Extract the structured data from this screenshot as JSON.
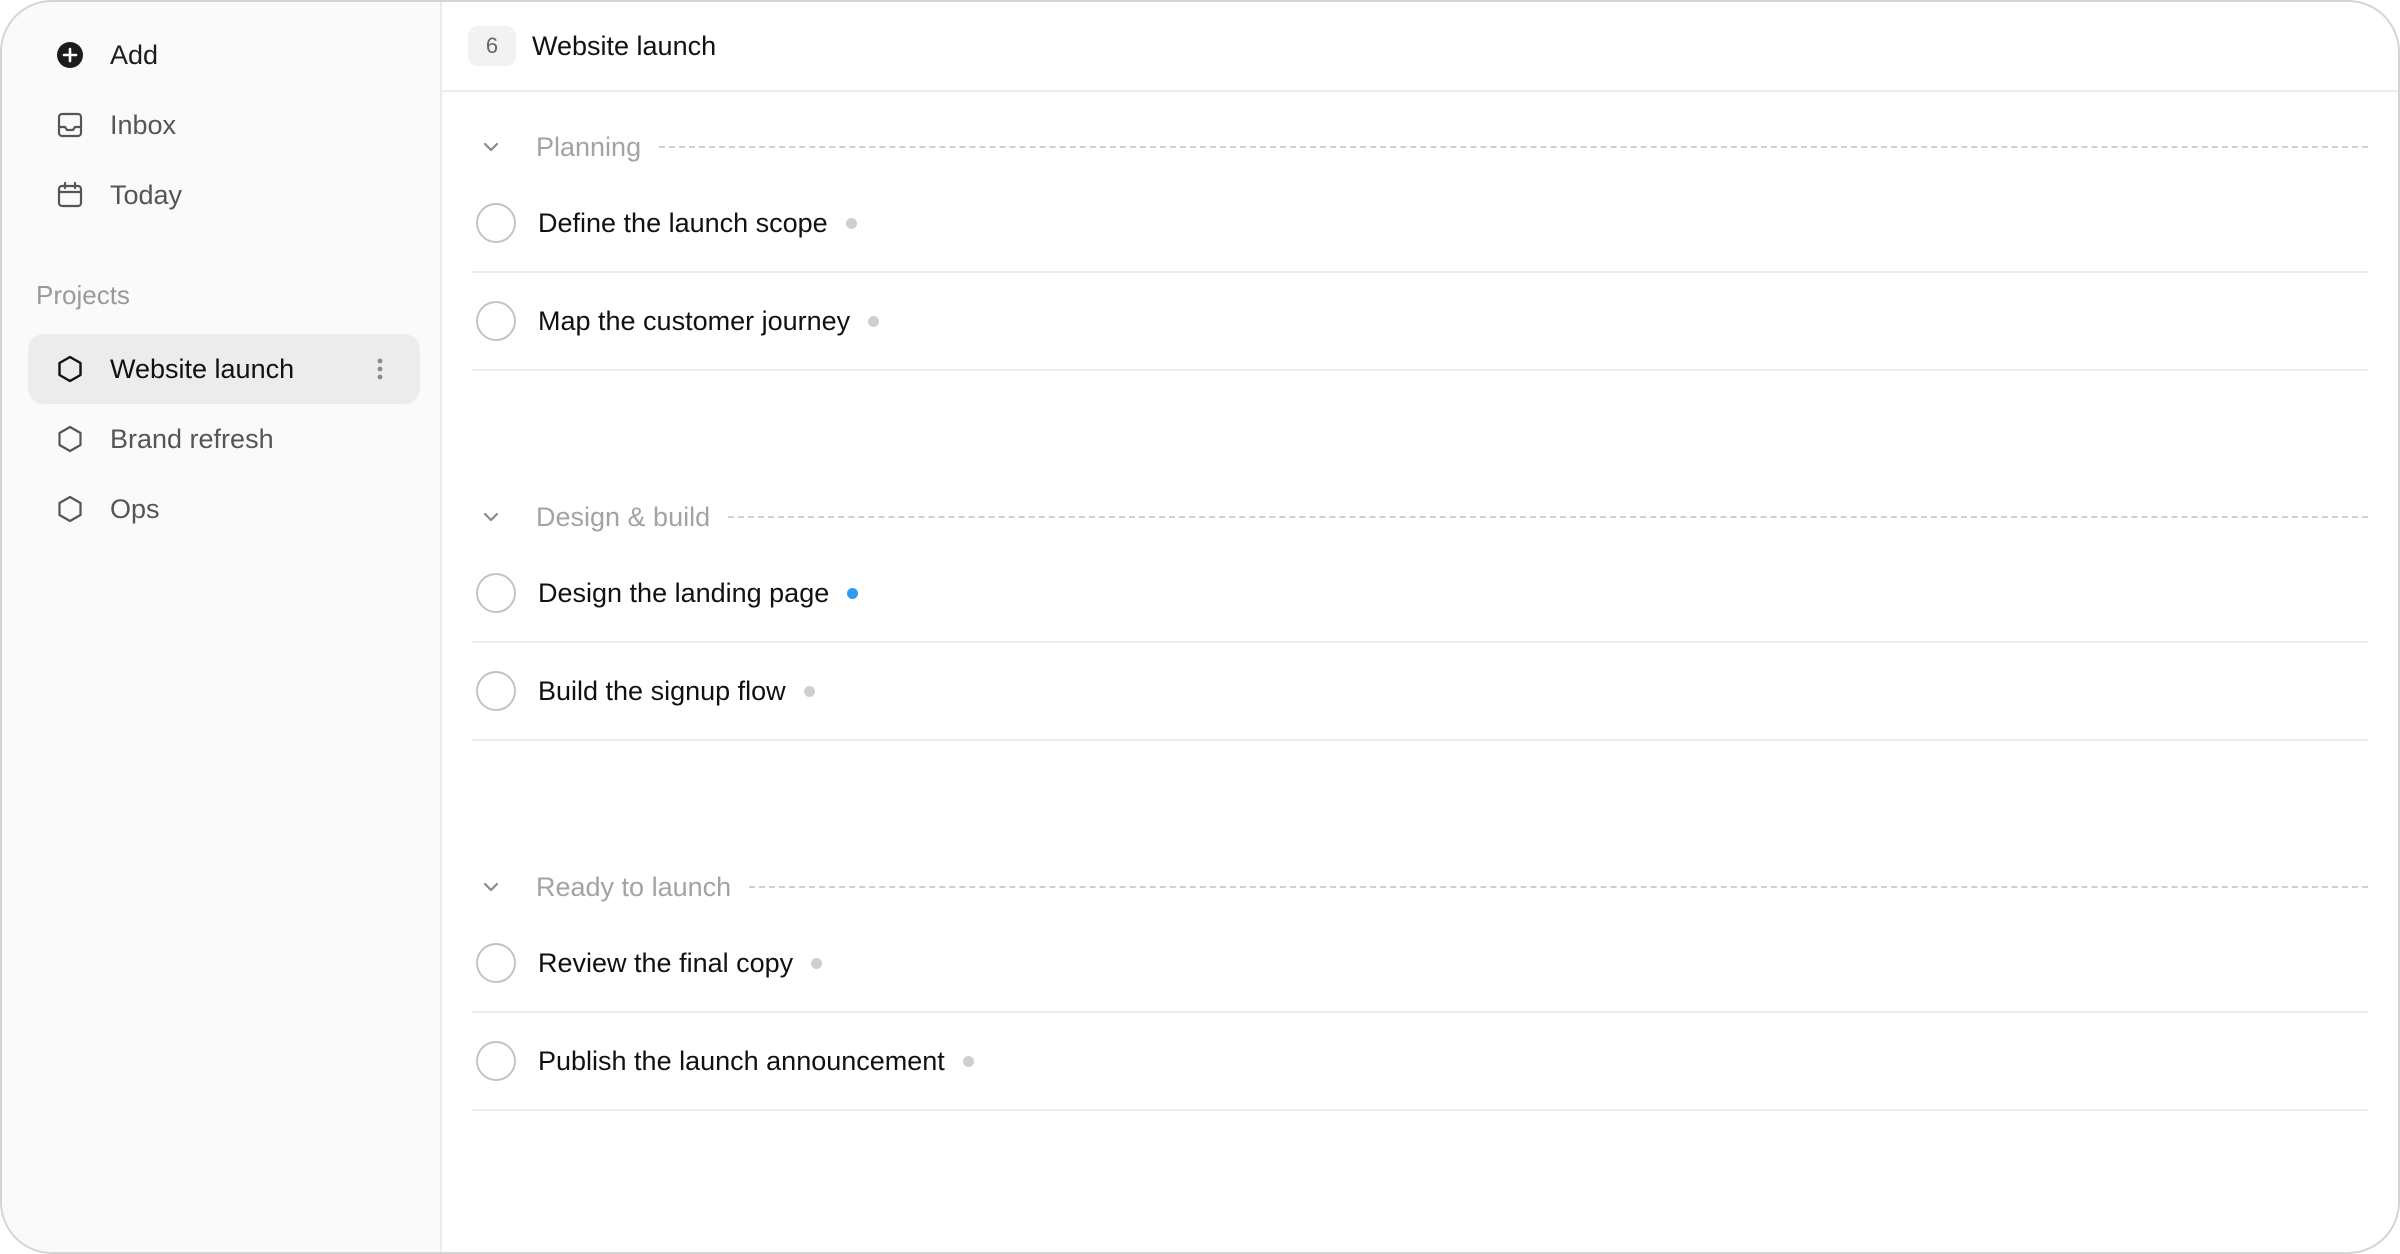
{
  "sidebar": {
    "nav": [
      {
        "label": "Add",
        "icon": "plus-circle-icon"
      },
      {
        "label": "Inbox",
        "icon": "inbox-icon"
      },
      {
        "label": "Today",
        "icon": "calendar-icon"
      }
    ],
    "section_label": "Projects",
    "projects": [
      {
        "label": "Website launch",
        "icon": "hexagon-icon",
        "active": true
      },
      {
        "label": "Brand refresh",
        "icon": "hexagon-icon",
        "active": false
      },
      {
        "label": "Ops",
        "icon": "hexagon-icon",
        "active": false
      }
    ]
  },
  "header": {
    "count": "6",
    "title": "Website launch"
  },
  "groups": [
    {
      "name": "Planning",
      "tasks": [
        {
          "title": "Define the launch scope",
          "dot_color": "#cfcfcf"
        },
        {
          "title": "Map the customer journey",
          "dot_color": "#cfcfcf"
        }
      ]
    },
    {
      "name": "Design & build",
      "tasks": [
        {
          "title": "Design the landing page",
          "dot_color": "#2f9bf0"
        },
        {
          "title": "Build the signup flow",
          "dot_color": "#cfcfcf"
        }
      ]
    },
    {
      "name": "Ready to launch",
      "tasks": [
        {
          "title": "Review the final copy",
          "dot_color": "#cfcfcf"
        },
        {
          "title": "Publish the launch announcement",
          "dot_color": "#cfcfcf"
        }
      ]
    }
  ],
  "colors": {
    "accent": "#2f9bf0",
    "active_bg": "#ececec"
  }
}
